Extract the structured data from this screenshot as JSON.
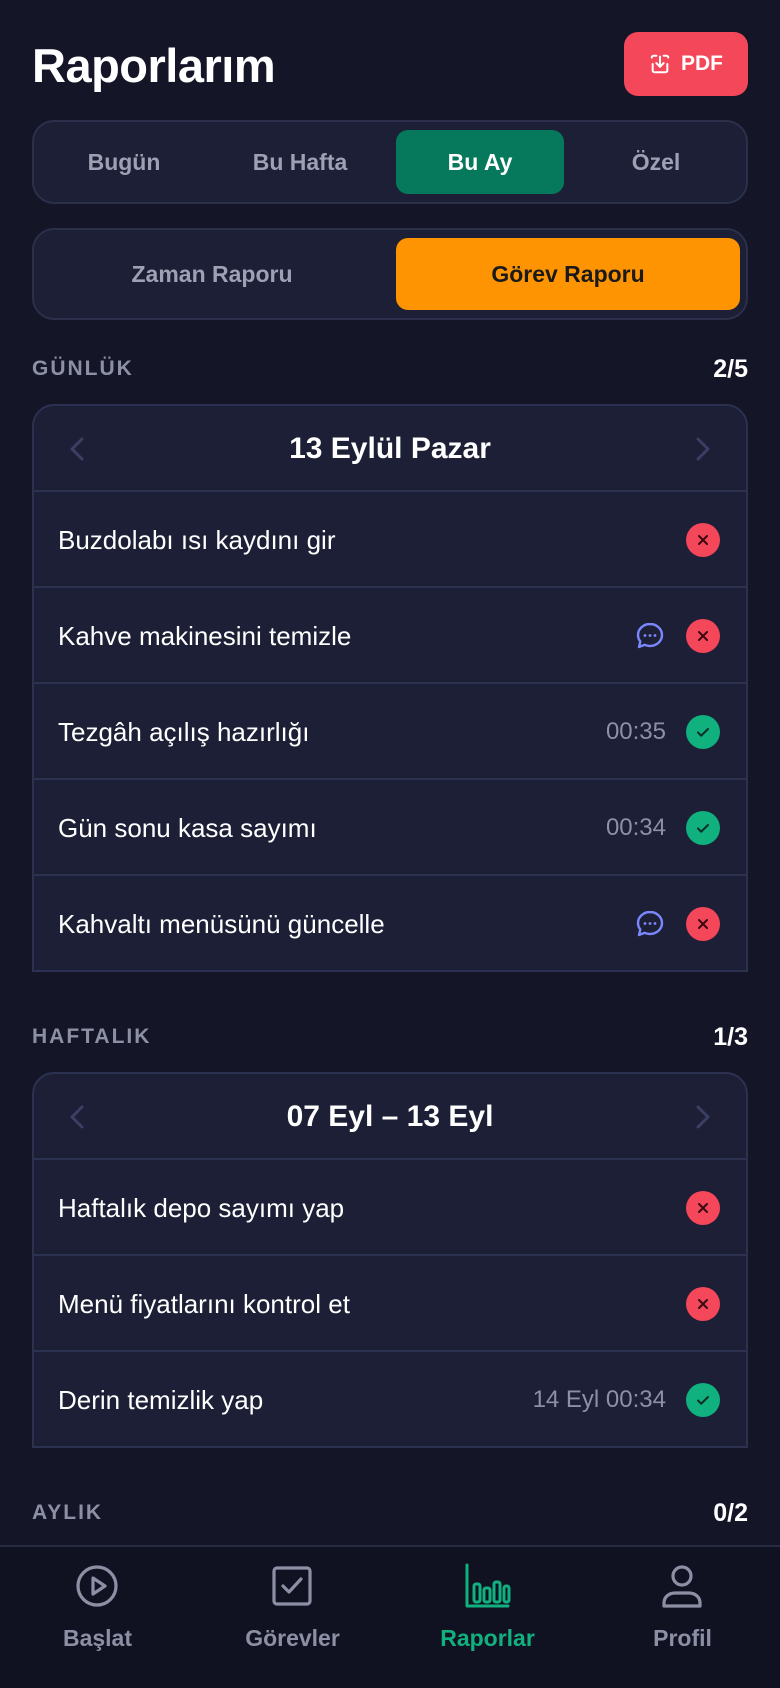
{
  "header": {
    "title": "Raporlarım",
    "pdf_label": "PDF"
  },
  "period_tabs": [
    "Bugün",
    "Bu Hafta",
    "Bu Ay",
    "Özel"
  ],
  "period_selected": "Bu Ay",
  "report_tabs": [
    "Zaman Raporu",
    "Görev Raporu"
  ],
  "report_selected": "Görev Raporu",
  "sections": {
    "daily": {
      "label": "GÜNLÜK",
      "count": "2/5",
      "date": "13 Eylül Pazar",
      "tasks": [
        {
          "name": "Buzdolabı ısı kaydını gir",
          "status": "fail"
        },
        {
          "name": "Kahve makinesini temizle",
          "status": "fail",
          "comment": "chat-icon"
        },
        {
          "name": "Tezgâh açılış hazırlığı",
          "time": "00:35",
          "status": "ok"
        },
        {
          "name": "Gün sonu kasa sayımı",
          "time": "00:34",
          "status": "ok"
        },
        {
          "name": "Kahvaltı menüsünü güncelle",
          "status": "fail",
          "comment": "chat-icon"
        }
      ]
    },
    "weekly": {
      "label": "HAFTALIK",
      "count": "1/3",
      "date": "07 Eyl – 13 Eyl",
      "tasks": [
        {
          "name": "Haftalık depo sayımı yap",
          "status": "fail"
        },
        {
          "name": "Menü fiyatlarını kontrol et",
          "status": "fail"
        },
        {
          "name": "Derin temizlik yap",
          "time": "14 Eyl 00:34",
          "status": "ok"
        }
      ]
    },
    "monthly": {
      "label": "AYLIK",
      "count": "0/2"
    }
  },
  "tabbar": [
    {
      "label": "Başlat",
      "icon": "play-icon"
    },
    {
      "label": "Görevler",
      "icon": "checkbox-icon"
    },
    {
      "label": "Raporlar",
      "icon": "bar-chart-icon",
      "active": true
    },
    {
      "label": "Profil",
      "icon": "user-icon"
    }
  ],
  "colors": {
    "background": "#141628",
    "card": "#1c1f35",
    "accent_green": "#06785c",
    "accent_orange": "#ff9402",
    "danger": "#f4475a",
    "success": "#10b07f",
    "comment": "#7b87ff"
  }
}
